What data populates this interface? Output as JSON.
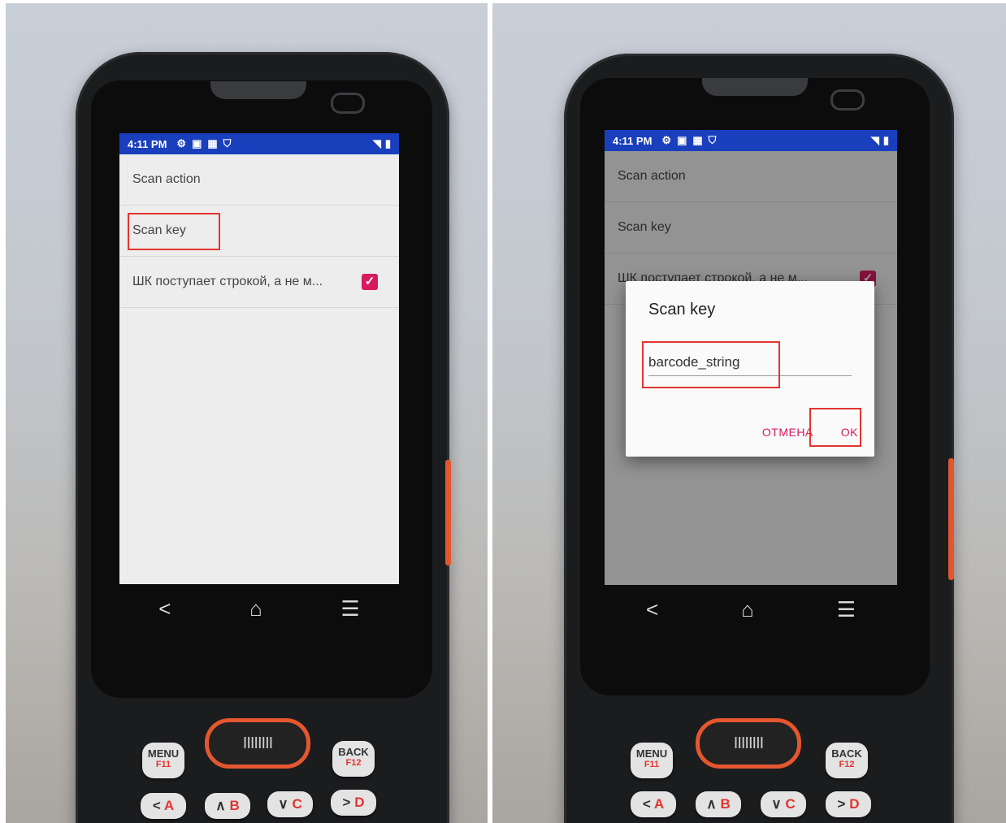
{
  "left": {
    "status": {
      "time": "4:11 PM",
      "icons": [
        "gear-icon",
        "sim-icon",
        "keyboard-icon",
        "shield-icon"
      ],
      "right_icons": [
        "wifi-icon",
        "battery-icon"
      ]
    },
    "prefs": [
      {
        "label": "Scan action"
      },
      {
        "label": "Scan key"
      },
      {
        "label": "ШК поступает строкой, а не м...",
        "checked": true
      }
    ],
    "nav": {
      "back": "<",
      "home": "⌂",
      "recents": "☰"
    }
  },
  "right": {
    "status": {
      "time": "4:11 PM"
    },
    "prefs": [
      {
        "label": "Scan action"
      },
      {
        "label": "Scan key"
      },
      {
        "label": "ШК поступает строкой, а не м...",
        "checked": true
      }
    ],
    "dialog": {
      "title": "Scan key",
      "value": "barcode_string",
      "cancel": "ОТМЕНА",
      "ok": "OK"
    },
    "nav": {
      "back": "<",
      "home": "⌂",
      "recents": "☰"
    }
  },
  "keypad": {
    "menu": "MENU",
    "menu_fn": "F11",
    "back": "BACK",
    "back_fn": "F12",
    "scan": "IIIIIIII",
    "keys": [
      {
        "arrow": "<",
        "letter": "A"
      },
      {
        "arrow": "∧",
        "letter": "B"
      },
      {
        "arrow": "∨",
        "letter": "C"
      },
      {
        "arrow": ">",
        "letter": "D"
      }
    ]
  },
  "colors": {
    "statusbar": "#1a3fbd",
    "accent": "#d81b60",
    "highlight": "#e3342f"
  }
}
